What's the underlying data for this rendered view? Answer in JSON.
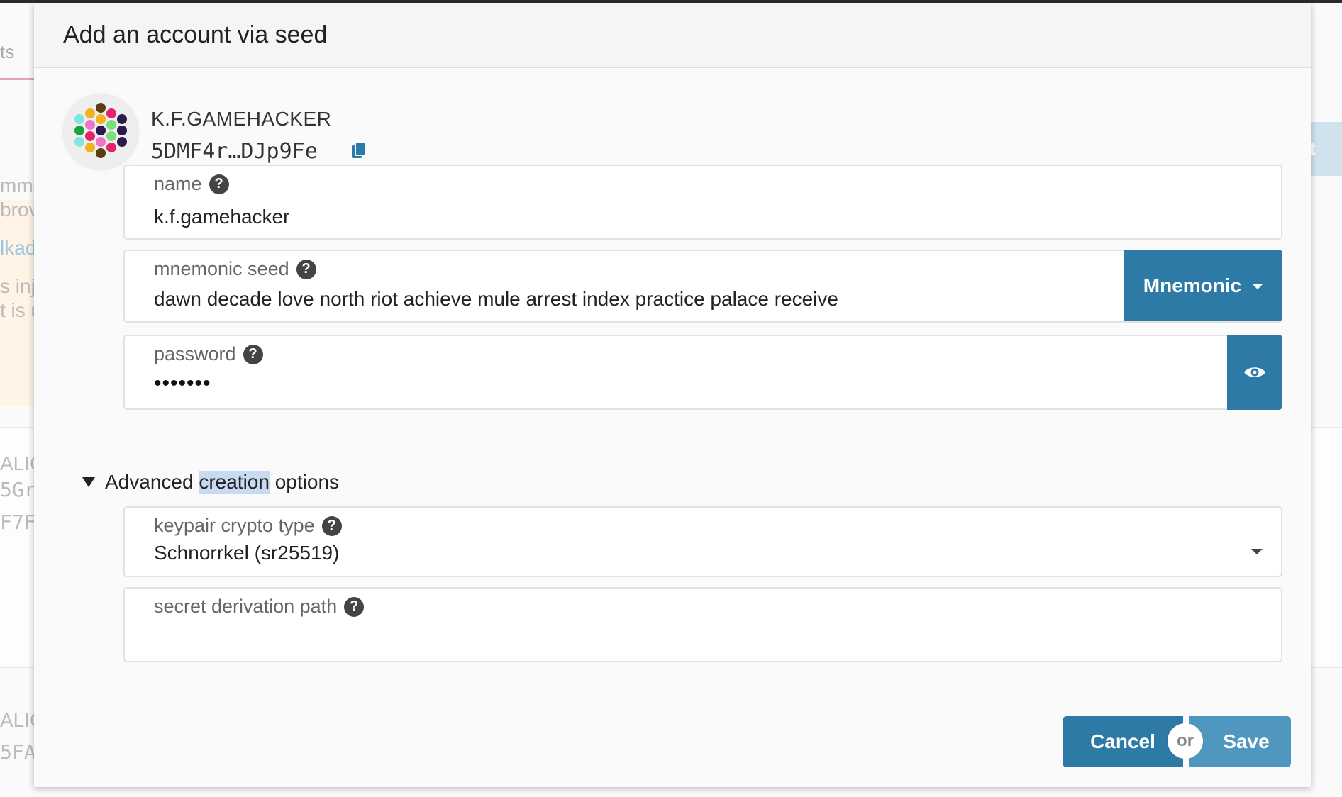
{
  "background": {
    "tab_fragment": "ts",
    "notice_fragments": [
      "mme",
      "brov",
      "lkad",
      "s inje",
      "t is u"
    ],
    "account_fragments": [
      "ALIC",
      "5Gr",
      "F7F",
      "ALIC",
      "5FA"
    ],
    "right_button_fragment": "t"
  },
  "modal": {
    "title": "Add an account via seed"
  },
  "identity": {
    "name": "K.F.GAMEHACKER",
    "address": "5DMF4r…DJp9Fe"
  },
  "fields": {
    "name": {
      "label": "name",
      "value": "k.f.gamehacker"
    },
    "seed": {
      "label": "mnemonic seed",
      "value": "dawn decade love north riot achieve mule arrest index practice palace receive",
      "type_button": "Mnemonic"
    },
    "password": {
      "label": "password",
      "value_masked": "•••••••"
    },
    "crypto_type": {
      "label": "keypair crypto type",
      "value": "Schnorrkel (sr25519)"
    },
    "derivation_path": {
      "label": "secret derivation path",
      "value": ""
    }
  },
  "advanced": {
    "label_before": "Advanced ",
    "label_highlight": "creation",
    "label_after": " options",
    "expanded": true
  },
  "footer": {
    "cancel_label": "Cancel",
    "or_label": "or",
    "save_label": "Save"
  },
  "colors": {
    "primary": "#2e7aa6",
    "save": "#4f97be",
    "text_highlight": "#c8daf2"
  },
  "icons": {
    "copy": "copy-icon",
    "help": "help-icon",
    "eye": "eye-icon",
    "dropdown": "chevron-down-icon",
    "advanced_toggle": "triangle-down-icon"
  }
}
